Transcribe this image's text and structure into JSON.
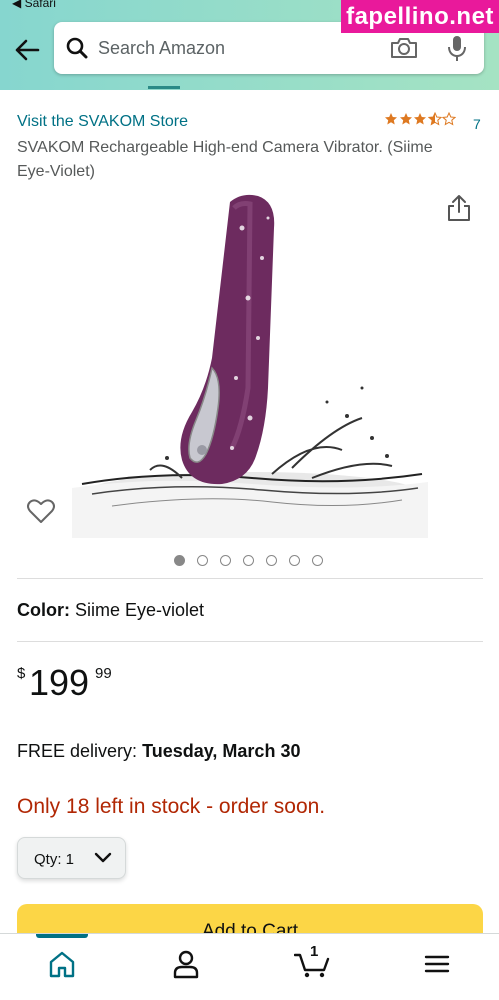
{
  "status_bar": {
    "back_label": "◀ Safari"
  },
  "watermark": {
    "text": "fapellino.net",
    "color": "#e9199b"
  },
  "search": {
    "placeholder": "Search Amazon"
  },
  "product": {
    "store_link": "Visit the SVAKOM Store",
    "rating": {
      "stars": 3.5,
      "max": 5,
      "count": "7"
    },
    "title": "SVAKOM Rechargeable High-end Camera Vibrator. (Siime Eye-Violet)",
    "image_icon": "purple-vibrator-product-photo",
    "image_count": 7,
    "active_image": 0,
    "color_label": "Color:",
    "color_value": "Siime Eye-violet",
    "price": {
      "symbol": "$",
      "whole": "199",
      "fraction": "99"
    },
    "delivery_prefix": "FREE delivery:",
    "delivery_date": "Tuesday, March 30",
    "stock_message": "Only 18 left in stock - order soon.",
    "stock_color": "#b12704",
    "quantity_label": "Qty: 1",
    "add_to_cart_label": "Add to Cart",
    "add_to_cart_color": "#fcd646"
  },
  "bottom_nav": {
    "items": [
      {
        "name": "home",
        "icon": "home-icon",
        "active": true
      },
      {
        "name": "account",
        "icon": "person-icon",
        "active": false
      },
      {
        "name": "cart",
        "icon": "cart-icon",
        "active": false
      },
      {
        "name": "menu",
        "icon": "hamburger-menu-icon",
        "active": false
      }
    ],
    "cart_count": "1",
    "accent_color": "#007185"
  }
}
